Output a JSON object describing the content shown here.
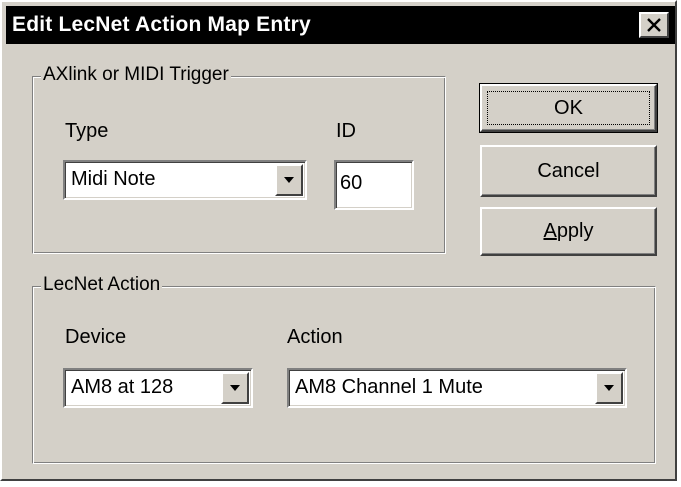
{
  "window": {
    "title": "Edit LecNet Action Map Entry",
    "close_symbol": "✕"
  },
  "trigger_group": {
    "title": "AXlink or MIDI Trigger",
    "type_label": "Type",
    "type_value": "Midi Note",
    "id_label": "ID",
    "id_value": "60"
  },
  "action_group": {
    "title": "LecNet Action",
    "device_label": "Device",
    "device_value": "AM8 at 128",
    "action_label": "Action",
    "action_value": "AM8 Channel 1 Mute"
  },
  "buttons": {
    "ok": "OK",
    "cancel": "Cancel",
    "apply_accel": "A",
    "apply_rest": "pply"
  },
  "icons": {
    "close": "close-icon",
    "dropdown": "chevron-down-icon"
  }
}
